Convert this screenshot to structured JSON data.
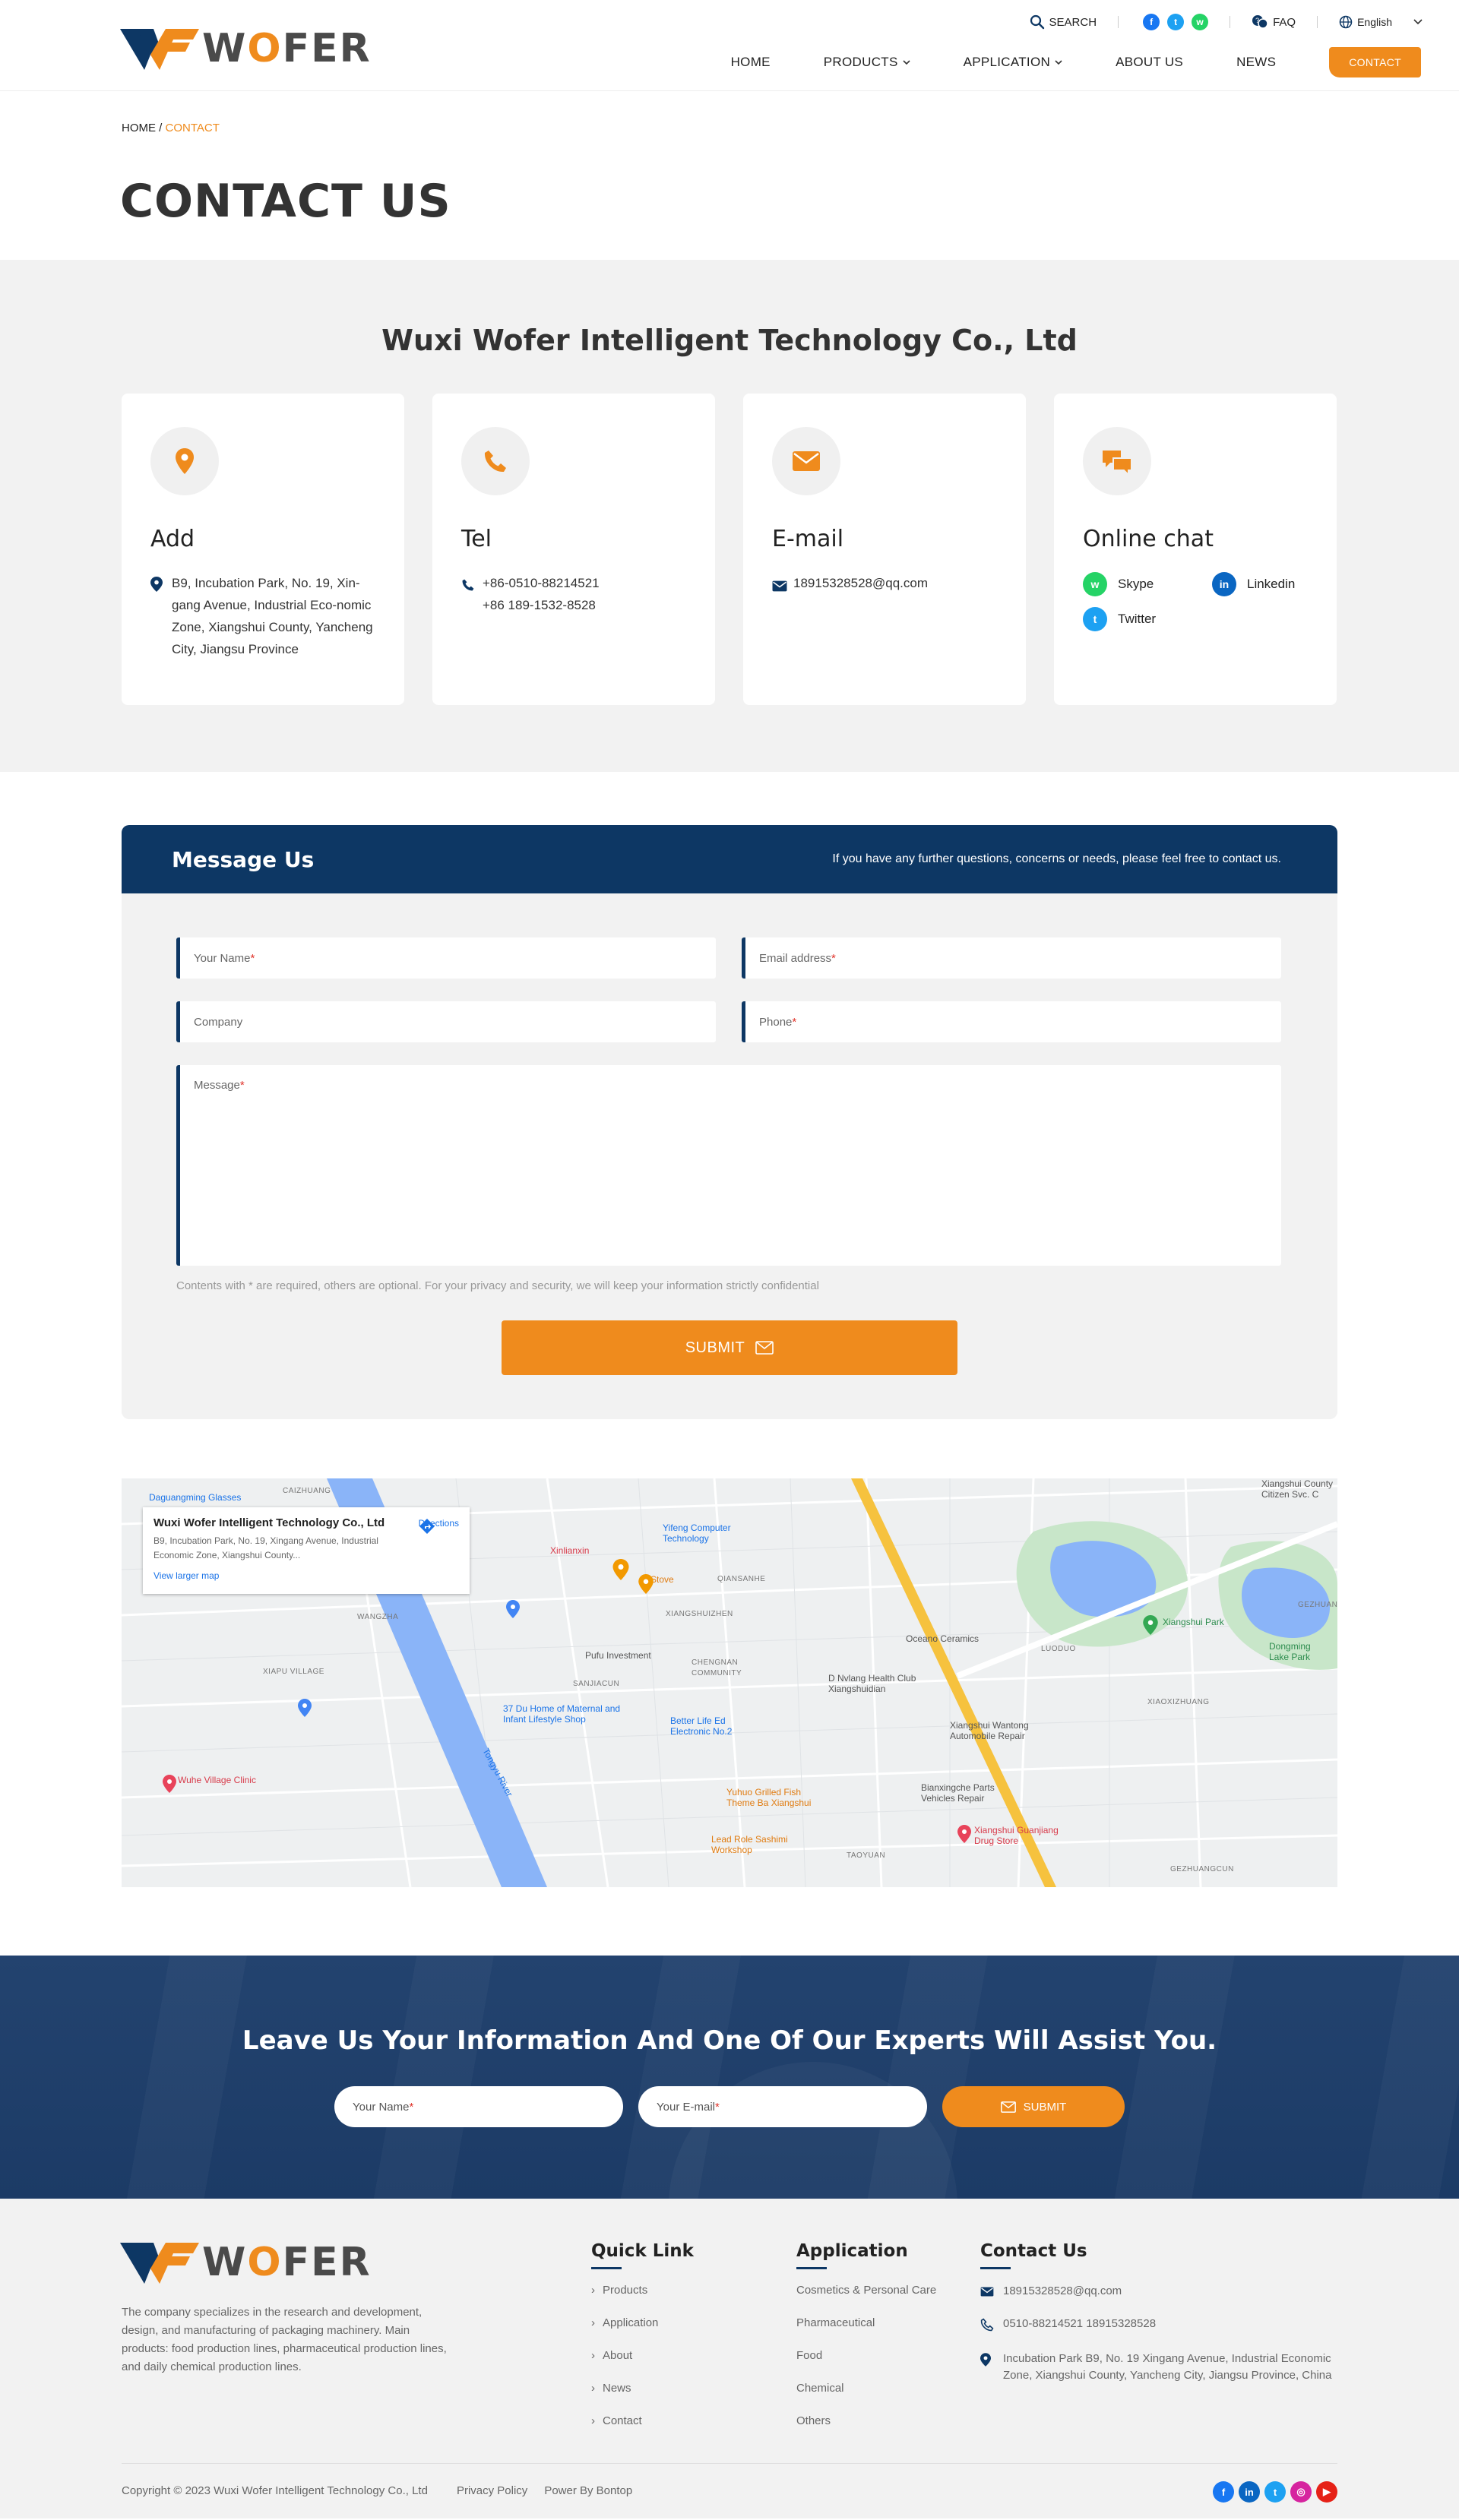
{
  "header": {
    "logo_text_pre": "W",
    "logo_text_o": "O",
    "logo_text_post": "FER",
    "search_label": "SEARCH",
    "faq_label": "FAQ",
    "language": "English",
    "nav": [
      "HOME",
      "PRODUCTS",
      "APPLICATION",
      "ABOUT US",
      "NEWS"
    ],
    "contact_button": "CONTACT"
  },
  "breadcrumb": {
    "home": "HOME /",
    "current": "CONTACT"
  },
  "page_title": "CONTACT US",
  "company": {
    "name": "Wuxi Wofer Intelligent Technology Co., Ltd",
    "address": {
      "title": "Add",
      "text": "B9, Incubation Park, No. 19, Xin-gang Avenue, Industrial Eco-nomic Zone, Xiangshui County, Yancheng City, Jiangsu Province"
    },
    "tel": {
      "title": "Tel",
      "line1": "+86-0510-88214521",
      "line2": "+86 189-1532-8528"
    },
    "email": {
      "title": "E-mail",
      "text": "18915328528@qq.com"
    },
    "chat": {
      "title": "Online chat",
      "skype": "Skype",
      "linkedin": "Linkedin",
      "twitter": "Twitter"
    }
  },
  "message_form": {
    "title": "Message Us",
    "subtitle": "If you have any further questions, concerns or needs, please feel free to contact us.",
    "name_placeholder": "Your Name",
    "email_placeholder": "Email address",
    "company_placeholder": "Company",
    "phone_placeholder": "Phone",
    "message_placeholder": "Message",
    "required_mark": "*",
    "note": "Contents with * are required, others are optional. For your privacy and security, we will keep your information strictly confidential",
    "submit_label": "SUBMIT"
  },
  "map": {
    "card_title": "Wuxi Wofer Intelligent Technology Co., Ltd",
    "card_address": "B9, Incubation Park, No. 19, Xingang Avenue, Industrial Economic Zone, Xiangshui County...",
    "larger_map": "View larger map",
    "directions": "Directions",
    "labels": {
      "daguangming": "Daguangming Glasses",
      "caizhuang": "CAIZHUANG",
      "xinlianxin": "Xinlianxin",
      "yifeng": "Yifeng Computer Technology",
      "stove": "Stove",
      "qiansanhe": "QIANSANHE",
      "xiangshuizhen": "XIANGSHUIZHEN",
      "wangzha": "WANGZHA",
      "xiapu": "XIAPU VILLAGE",
      "pufu": "Pufu Investment",
      "sanjiacun": "SANJIACUN",
      "chengnan": "CHENGNAN COMMUNITY",
      "maternal": "37 Du Home of Maternal and Infant Lifestyle Shop",
      "betterlife": "Better Life Ed Electronic No.2",
      "oceano": "Oceano Ceramics",
      "luodo": "LUODUO",
      "dnvlang": "D Nvlang Health Club Xiangshuidian",
      "xiangshuipark": "Xiangshui Park",
      "dongming": "Dongming Lake Park",
      "wantong": "Xiangshui Wantong Automobile Repair",
      "xiaoxizhuang": "XIAOXIZHUANG",
      "wuhe": "Wuhe Village Clinic",
      "yuhuo": "Yuhuo Grilled Fish Theme Ba Xiangshui",
      "bianxingche": "Bianxingche Parts Vehicles Repair",
      "leadrole": "Lead Role Sashimi Workshop",
      "guanjiang": "Xiangshui Guanjiang Drug Store",
      "taoyuan": "TAOYUAN",
      "gezhuangcun": "GEZHUANGCUN",
      "gezhuang": "GEZHUANG",
      "citizensvc": "Xiangshui County Citizen Svc. C",
      "tongyu": "Tongyu River"
    }
  },
  "cta": {
    "title": "Leave Us Your Information And One Of Our Experts Will Assist You.",
    "name_placeholder": "Your Name",
    "email_placeholder": "Your E-mail",
    "required_mark": "*",
    "submit_label": "SUBMIT"
  },
  "footer": {
    "description": "The company specializes in the research and development, design, and manufacturing of packaging machinery. Main products: food production lines, pharmaceutical production lines, and daily chemical production lines.",
    "quick_link_title": "Quick Link",
    "quick_links": [
      "Products",
      "Application",
      "About",
      "News",
      "Contact"
    ],
    "application_title": "Application",
    "applications": [
      "Cosmetics & Personal Care",
      "Pharmaceutical",
      "Food",
      "Chemical",
      "Others"
    ],
    "contact_title": "Contact Us",
    "contact_email": "18915328528@qq.com",
    "contact_phone": "0510-88214521  18915328528",
    "contact_address": "Incubation Park B9, No. 19 Xingang Avenue, Industrial Economic Zone, Xiangshui County, Yancheng City, Jiangsu Province, China",
    "copyright": "Copyright © 2023  Wuxi Wofer Intelligent Technology Co., Ltd",
    "privacy": "Privacy Policy",
    "power": "Power By Bontop"
  },
  "colors": {
    "accent": "#ef8b1d",
    "navy": "#0d3764",
    "whatsapp": "#25d366",
    "facebook": "#1877f2",
    "twitter": "#1da1f2",
    "linkedin": "#0a66c2"
  }
}
